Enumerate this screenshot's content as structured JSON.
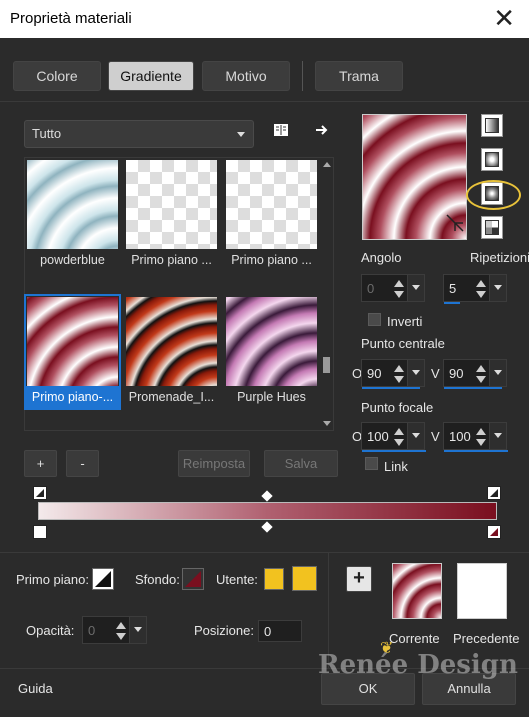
{
  "window": {
    "title": "Proprietà materiali",
    "close_glyph": "✕"
  },
  "tabs": [
    {
      "label": "Colore",
      "active": false
    },
    {
      "label": "Gradiente",
      "active": true
    },
    {
      "label": "Motivo",
      "active": false
    },
    {
      "label": "Trama",
      "active": false
    }
  ],
  "gallery": {
    "filter": "Tutto",
    "items": [
      {
        "caption": "powderblue"
      },
      {
        "caption": "Primo piano ..."
      },
      {
        "caption": "Primo piano ..."
      },
      {
        "caption": "Primo piano-..."
      },
      {
        "caption": "Promenade_I..."
      },
      {
        "caption": "Purple Hues"
      }
    ],
    "add_label": "+",
    "remove_label": "-",
    "reset_label": "Reimposta",
    "save_label": "Salva"
  },
  "settings": {
    "angle_label": "Angolo",
    "angle_value": "0",
    "repeats_label": "Ripetizioni",
    "repeats_value": "5",
    "invert_label": "Inverti",
    "center_label": "Punto centrale",
    "center_h_prefix": "O",
    "center_h": "90",
    "center_v_prefix": "V",
    "center_v": "90",
    "focal_label": "Punto focale",
    "focal_h_prefix": "O",
    "focal_h": "100",
    "focal_v_prefix": "V",
    "focal_v": "100",
    "link_label": "Link"
  },
  "bottom": {
    "fg_label": "Primo piano:",
    "bg_label": "Sfondo:",
    "user_label": "Utente:",
    "opacity_label": "Opacità:",
    "opacity_value": "0",
    "position_label": "Posizione:",
    "position_value": "0",
    "current_label": "Corrente",
    "previous_label": "Precedente",
    "plus_label": "+"
  },
  "footer": {
    "help_label": "Guida",
    "ok_label": "OK",
    "cancel_label": "Annulla",
    "watermark": "Renée Design"
  },
  "colors": {
    "accent": "#1e74d2",
    "gradient_dark": "#7a0f1f",
    "user_yellow": "#f2c21f",
    "highlight_ring": "#e8c23a"
  }
}
